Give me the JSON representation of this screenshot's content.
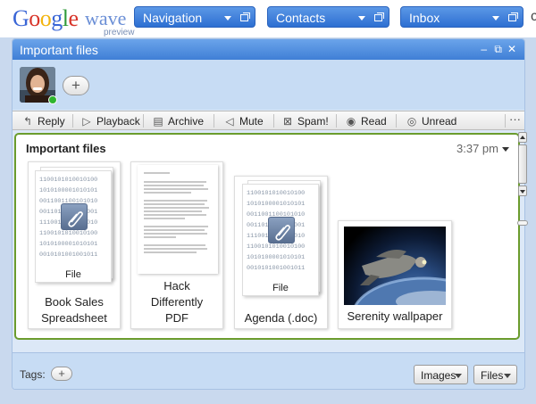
{
  "logo": {
    "google": "Google",
    "wave": "wave",
    "preview": "preview"
  },
  "nav": [
    {
      "label": "Navigation"
    },
    {
      "label": "Contacts"
    },
    {
      "label": "Inbox"
    }
  ],
  "wave": {
    "title": "Important files",
    "toolbar": [
      {
        "label": "Reply",
        "icon": "reply-icon"
      },
      {
        "label": "Playback",
        "icon": "playback-icon"
      },
      {
        "label": "Archive",
        "icon": "archive-icon"
      },
      {
        "label": "Mute",
        "icon": "mute-icon"
      },
      {
        "label": "Spam!",
        "icon": "spam-icon"
      },
      {
        "label": "Read",
        "icon": "read-icon"
      },
      {
        "label": "Unread",
        "icon": "unread-icon"
      }
    ],
    "more": "···",
    "blip": {
      "title": "Important files",
      "time": "3:37 pm"
    },
    "attachments": [
      {
        "kind": "file",
        "type_label": "File",
        "name_lines": [
          "Book Sales",
          "Spreadsheet"
        ]
      },
      {
        "kind": "document",
        "name_lines": [
          "Hack",
          "Differently",
          "PDF"
        ]
      },
      {
        "kind": "file",
        "type_label": "File",
        "name_lines": [
          "Agenda (.doc)"
        ]
      },
      {
        "kind": "image",
        "name_lines": [
          "Serenity wallpaper"
        ]
      }
    ],
    "binary_text": "1100101010010100\n1010100001010101\n0011001100101010\n0011010100101001\n1110011011010010\n1100101010010100\n1010100001010101\n0010101001001011",
    "footer": {
      "tags_label": "Tags:",
      "add": "+",
      "images_btn": "Images",
      "files_btn": "Files"
    }
  },
  "colors": {
    "nav_blue": "#3b7fd8",
    "title_blue": "#4f8de0",
    "blip_border": "#6b9c2d",
    "online_green": "#2fb52f"
  }
}
